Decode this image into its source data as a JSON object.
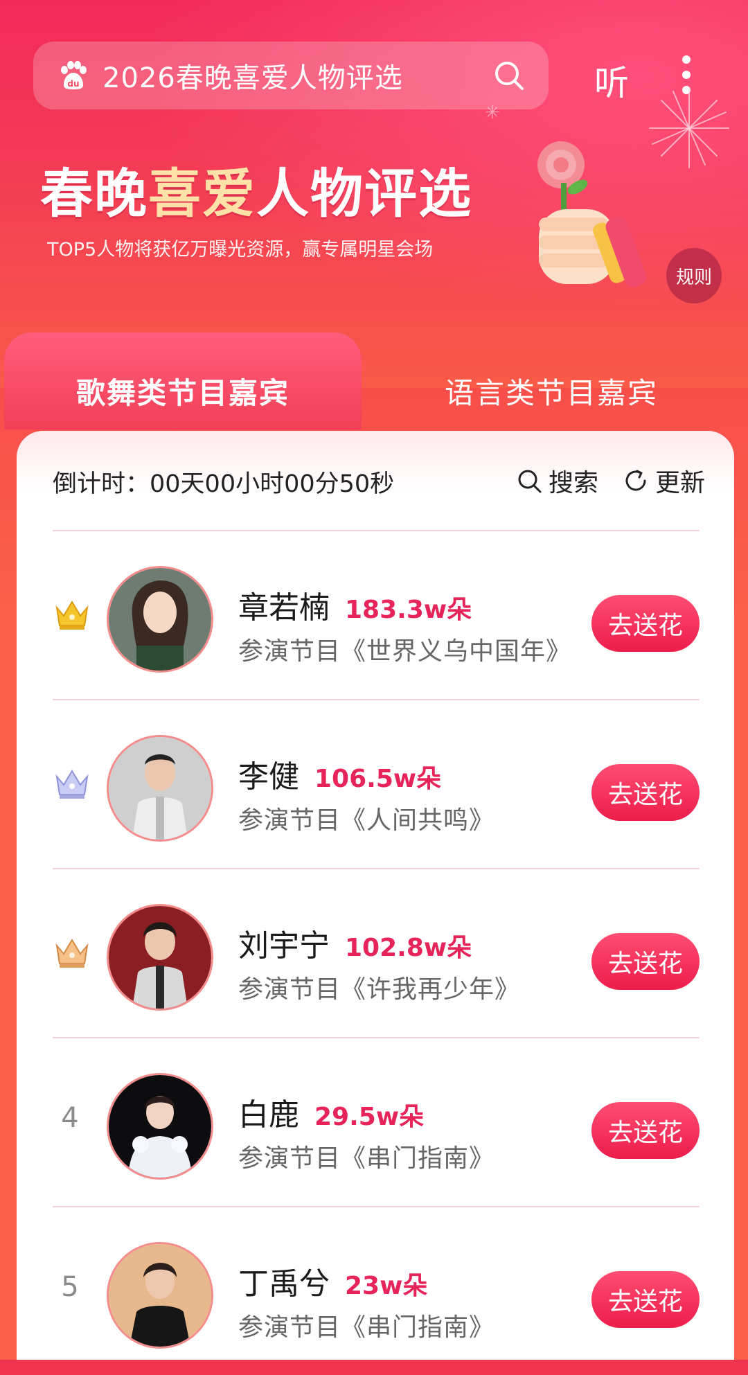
{
  "colors": {
    "accent": "#ec1d4a",
    "score": "#e6245a",
    "background": "#f74a4a"
  },
  "header": {
    "search_placeholder": "2026春晚喜爱人物评选",
    "listen_label": "听"
  },
  "banner": {
    "title_part1": "春晚",
    "title_highlight": "喜爱",
    "title_part2": "人物评选",
    "subtitle": "TOP5人物将获亿万曝光资源，赢专属明星会场",
    "rules_label": "规则"
  },
  "tabs": [
    {
      "label": "歌舞类节目嘉宾",
      "active": true
    },
    {
      "label": "语言类节目嘉宾",
      "active": false
    }
  ],
  "countdown": {
    "label": "倒计时：",
    "value": "00天00小时00分50秒"
  },
  "actions": {
    "search_label": "搜索",
    "refresh_label": "更新"
  },
  "entries": [
    {
      "rank": "1",
      "badge": "gold-crown",
      "name": "章若楠",
      "score": "183.3w朵",
      "program": "参演节目《世界义乌中国年》",
      "button": "去送花"
    },
    {
      "rank": "2",
      "badge": "silver-crown",
      "name": "李健",
      "score": "106.5w朵",
      "program": "参演节目《人间共鸣》",
      "button": "去送花"
    },
    {
      "rank": "3",
      "badge": "bronze-crown",
      "name": "刘宇宁",
      "score": "102.8w朵",
      "program": "参演节目《许我再少年》",
      "button": "去送花"
    },
    {
      "rank": "4",
      "badge": "",
      "name": "白鹿",
      "score": "29.5w朵",
      "program": "参演节目《串门指南》",
      "button": "去送花"
    },
    {
      "rank": "5",
      "badge": "",
      "name": "丁禹兮",
      "score": "23w朵",
      "program": "参演节目《串门指南》",
      "button": "去送花"
    }
  ]
}
